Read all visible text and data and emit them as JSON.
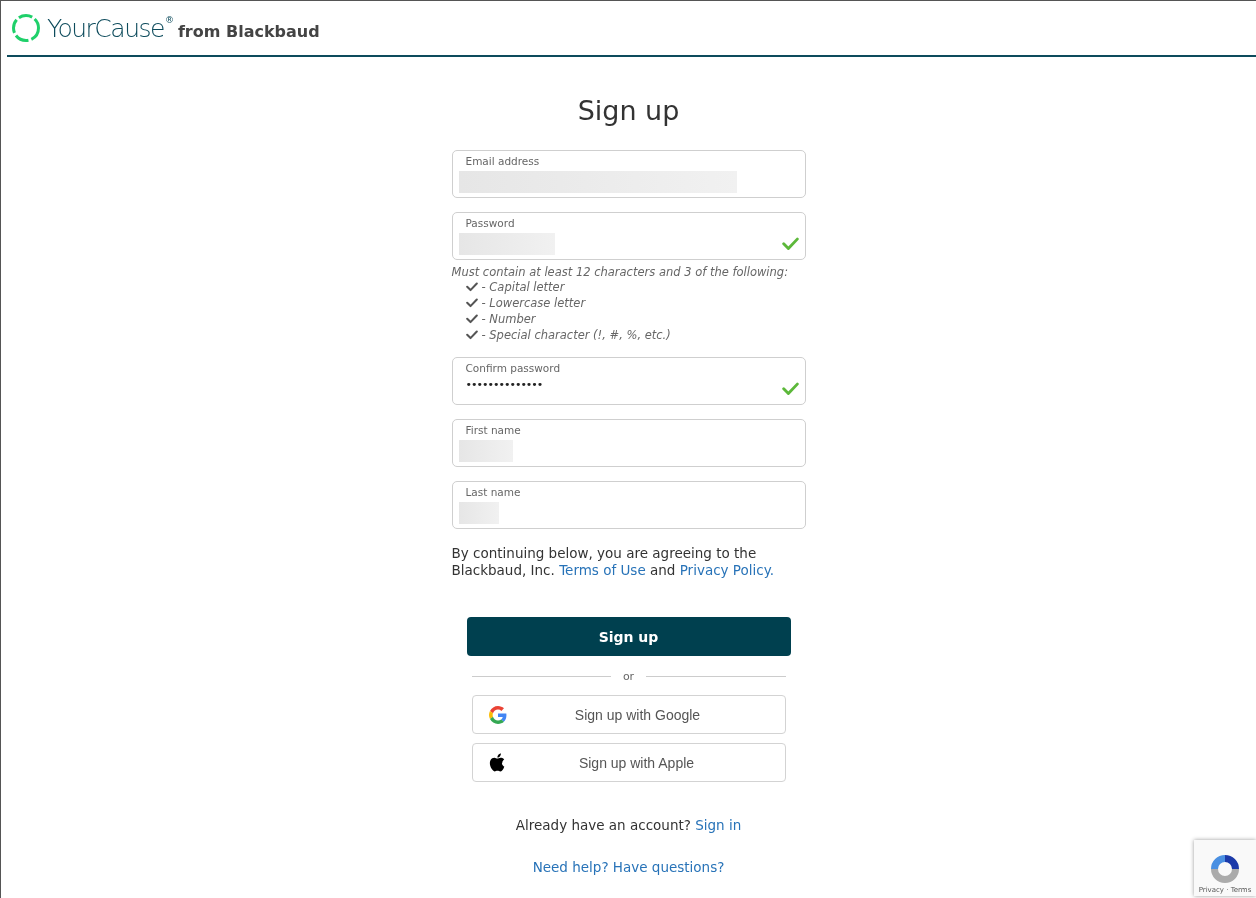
{
  "header": {
    "logo_name": "YourCause",
    "logo_mark": "®",
    "logo_suffix": "from Blackbaud"
  },
  "title": "Sign up",
  "fields": [
    {
      "label": "Email address",
      "redacted": true,
      "valid": false
    },
    {
      "label": "Password",
      "redacted": true,
      "valid": true
    },
    {
      "label": "Confirm password",
      "value": "••••••••••••••",
      "redacted": false,
      "valid": true
    },
    {
      "label": "First name",
      "redacted": true,
      "valid": false
    },
    {
      "label": "Last name",
      "redacted": true,
      "valid": false
    }
  ],
  "password_hint": "Must contain at least 12 characters and 3 of the following:",
  "password_rules": [
    {
      "text": "- Capital letter",
      "met": true
    },
    {
      "text": "- Lowercase letter",
      "met": true
    },
    {
      "text": "- Number",
      "met": true
    },
    {
      "text": "- Special character (!, #, %, etc.)",
      "met": true
    }
  ],
  "terms": {
    "before": "By continuing below, you are agreeing to the Blackbaud, Inc.",
    "link1": "Terms of Use",
    "middle": "and",
    "link2": "Privacy Policy."
  },
  "submit": "Sign up",
  "divider": "or",
  "social": [
    {
      "kind": "google",
      "label": "Sign up with Google"
    },
    {
      "kind": "apple",
      "label": "Sign up with Apple"
    }
  ],
  "signin": {
    "text": "Already have an account?",
    "link": "Sign in"
  },
  "help_link": "Need help? Have questions?",
  "recaptcha": {
    "privacy": "Privacy",
    "sep": "·",
    "terms": "Terms"
  }
}
